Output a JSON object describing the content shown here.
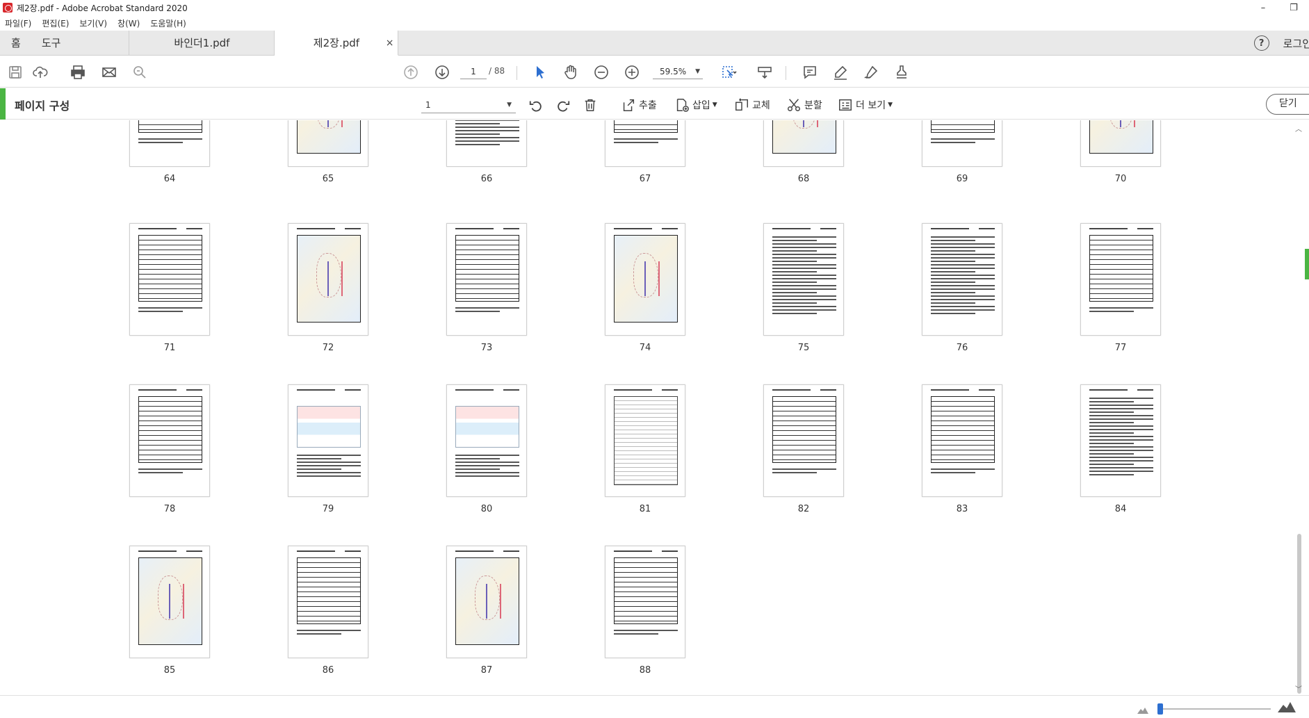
{
  "window": {
    "title": "제2장.pdf - Adobe Acrobat Standard 2020",
    "minimize": "–",
    "restore": "❐"
  },
  "menu": [
    "파일(F)",
    "편집(E)",
    "보기(V)",
    "창(W)",
    "도움말(H)"
  ],
  "tabs": {
    "home": "홈",
    "tools": "도구",
    "documents": [
      {
        "label": "바인더1.pdf",
        "active": false
      },
      {
        "label": "제2장.pdf",
        "active": true,
        "close": "×"
      }
    ],
    "help": "?",
    "login": "로그인"
  },
  "toolbar": {
    "current_page": "1",
    "total_pages": "/ 88",
    "zoom": "59.5%",
    "dropdown": "▼",
    "icons": [
      "save-icon",
      "upload-cloud-icon",
      "print-icon",
      "email-icon",
      "search-zoom-icon",
      "page-up-icon",
      "page-down-icon",
      "select-arrow-icon",
      "hand-icon",
      "zoom-out-icon",
      "zoom-in-icon",
      "marquee-icon",
      "scroll-mode-icon",
      "comment-icon",
      "highlight-pen-icon",
      "sign-icon",
      "stamp-icon"
    ]
  },
  "organize": {
    "title": "페이지 구성",
    "page_range": "1",
    "dropdown": "▼",
    "extract": "추출",
    "insert": "삽입",
    "replace": "교체",
    "split": "분할",
    "more": "더 보기",
    "close": "닫기"
  },
  "pages": [
    {
      "num": "64",
      "kind": "table"
    },
    {
      "num": "65",
      "kind": "map"
    },
    {
      "num": "66",
      "kind": "text"
    },
    {
      "num": "67",
      "kind": "table"
    },
    {
      "num": "68",
      "kind": "map"
    },
    {
      "num": "69",
      "kind": "table"
    },
    {
      "num": "70",
      "kind": "map"
    },
    {
      "num": "71",
      "kind": "table"
    },
    {
      "num": "72",
      "kind": "map"
    },
    {
      "num": "73",
      "kind": "table"
    },
    {
      "num": "74",
      "kind": "map"
    },
    {
      "num": "75",
      "kind": "text"
    },
    {
      "num": "76",
      "kind": "text"
    },
    {
      "num": "77",
      "kind": "table"
    },
    {
      "num": "78",
      "kind": "table"
    },
    {
      "num": "79",
      "kind": "color"
    },
    {
      "num": "80",
      "kind": "color"
    },
    {
      "num": "81",
      "kind": "diagram"
    },
    {
      "num": "82",
      "kind": "table"
    },
    {
      "num": "83",
      "kind": "table"
    },
    {
      "num": "84",
      "kind": "text"
    },
    {
      "num": "85",
      "kind": "map"
    },
    {
      "num": "86",
      "kind": "table"
    },
    {
      "num": "87",
      "kind": "map"
    },
    {
      "num": "88",
      "kind": "table"
    }
  ],
  "colors": {
    "accent_green": "#4bb543",
    "cursor_blue": "#2d6fd0",
    "tab_bar": "#e9e9e9"
  }
}
